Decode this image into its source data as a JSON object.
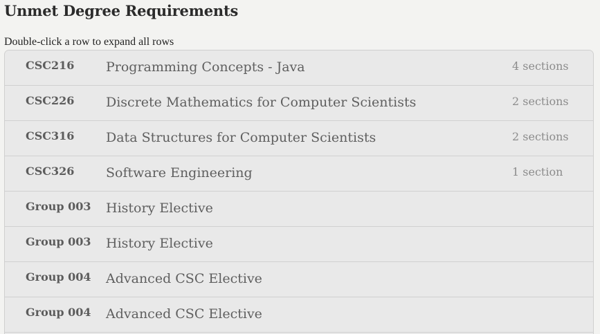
{
  "title": "Unmet Degree Requirements",
  "hint": "Double-click a row to expand all rows",
  "rows": [
    {
      "code": "CSC216",
      "name": "Programming Concepts - Java",
      "count": "4 sections"
    },
    {
      "code": "CSC226",
      "name": "Discrete Mathematics for Computer Scientists",
      "count": "2 sections"
    },
    {
      "code": "CSC316",
      "name": "Data Structures for Computer Scientists",
      "count": "2 sections"
    },
    {
      "code": "CSC326",
      "name": "Software Engineering",
      "count": "1 section"
    },
    {
      "code": "Group 003",
      "name": "History Elective",
      "count": ""
    },
    {
      "code": "Group 003",
      "name": "History Elective",
      "count": ""
    },
    {
      "code": "Group 004",
      "name": "Advanced CSC Elective",
      "count": ""
    },
    {
      "code": "Group 004",
      "name": "Advanced CSC Elective",
      "count": ""
    }
  ]
}
